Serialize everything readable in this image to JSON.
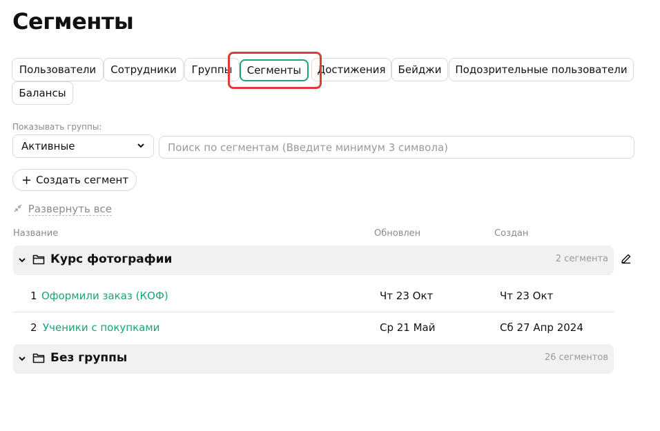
{
  "page_title": "Сегменты",
  "tabs": [
    {
      "label": "Пользователи",
      "active": false
    },
    {
      "label": "Сотрудники",
      "active": false
    },
    {
      "label": "Группы",
      "active": false
    },
    {
      "label": "Сегменты",
      "active": true
    },
    {
      "label": "Достижения",
      "active": false
    },
    {
      "label": "Бейджи",
      "active": false
    },
    {
      "label": "Подозрительные пользователи",
      "active": false
    },
    {
      "label": "Балансы",
      "active": false
    }
  ],
  "filter": {
    "label": "Показывать группы:",
    "selected": "Активные"
  },
  "search": {
    "placeholder": "Поиск по сегментам (Введите минимум 3 символа)",
    "value": ""
  },
  "create_button": "Создать сегмент",
  "expand_all": "Развернуть все",
  "columns": {
    "name": "Название",
    "updated": "Обновлен",
    "created": "Создан"
  },
  "groups": [
    {
      "name": "Курс фотографии",
      "count": "2 сегмента",
      "segments": [
        {
          "num": "1",
          "name": "Оформили заказ (КОФ)",
          "updated": "Чт 23 Окт",
          "created": "Чт 23 Окт"
        },
        {
          "num": "2",
          "name": "Ученики с покупками",
          "updated": "Ср 21 Май",
          "created": "Сб 27 Апр 2024"
        }
      ]
    },
    {
      "name": "Без группы",
      "count": "26 сегментов",
      "segments": []
    }
  ],
  "colors": {
    "accent": "#1aa37a",
    "highlight": "#dc3b3b",
    "group_bg": "#f1f1f1",
    "muted_text": "#8a8a8a"
  }
}
